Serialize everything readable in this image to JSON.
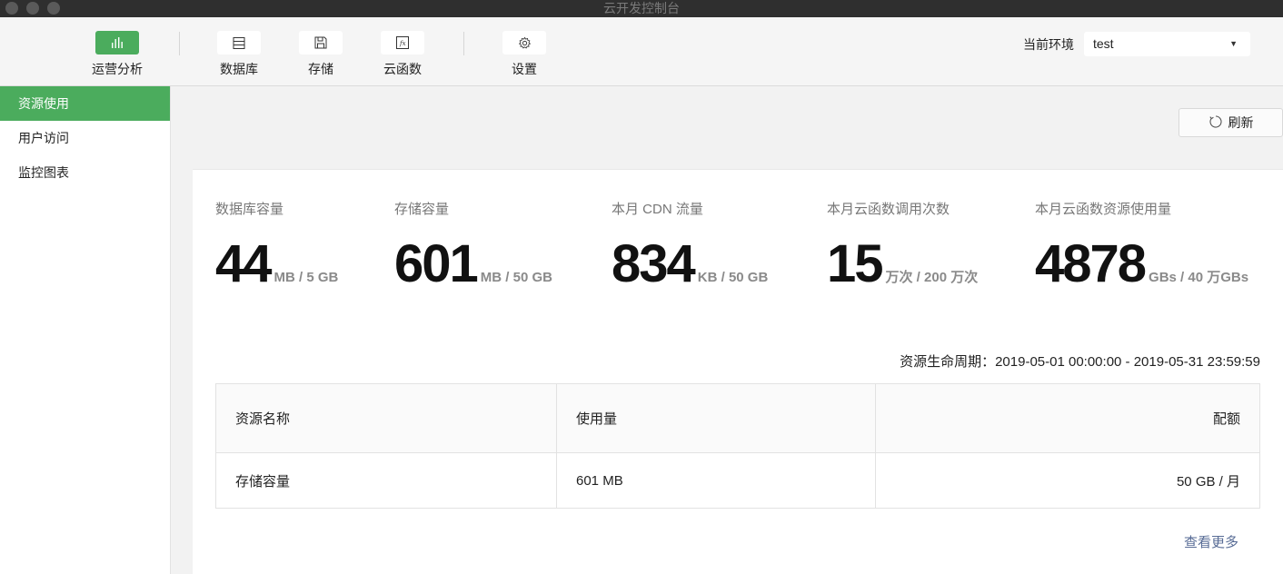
{
  "window": {
    "title": "云开发控制台"
  },
  "toolbar": {
    "tools": [
      {
        "label": "运营分析",
        "icon": "bar-chart-icon"
      },
      {
        "label": "数据库",
        "icon": "database-icon"
      },
      {
        "label": "存储",
        "icon": "storage-icon"
      },
      {
        "label": "云函数",
        "icon": "function-icon"
      },
      {
        "label": "设置",
        "icon": "gear-icon"
      }
    ],
    "env_label": "当前环境",
    "env_value": "test"
  },
  "sidebar": {
    "items": [
      {
        "label": "资源使用",
        "active": true
      },
      {
        "label": "用户访问",
        "active": false
      },
      {
        "label": "监控图表",
        "active": false
      }
    ]
  },
  "main": {
    "refresh_label": "刷新",
    "stats": [
      {
        "label": "数据库容量",
        "value": "44",
        "unit": "MB / 5 GB"
      },
      {
        "label": "存储容量",
        "value": "601",
        "unit": "MB / 50 GB"
      },
      {
        "label": "本月 CDN 流量",
        "value": "834",
        "unit": "KB / 50 GB"
      },
      {
        "label": "本月云函数调用次数",
        "value": "15",
        "unit": "万次 / 200 万次"
      },
      {
        "label": "本月云函数资源使用量",
        "value": "4878",
        "unit": "GBs / 40 万GBs"
      }
    ],
    "period": "资源生命周期：2019-05-01 00:00:00 - 2019-05-31 23:59:59",
    "table": {
      "headers": [
        "资源名称",
        "使用量",
        "配额"
      ],
      "rows": [
        [
          "存储容量",
          "601 MB",
          "50 GB / 月"
        ]
      ]
    },
    "more_label": "查看更多"
  },
  "colors": {
    "accent": "#4bac5d",
    "link": "#576b95"
  }
}
